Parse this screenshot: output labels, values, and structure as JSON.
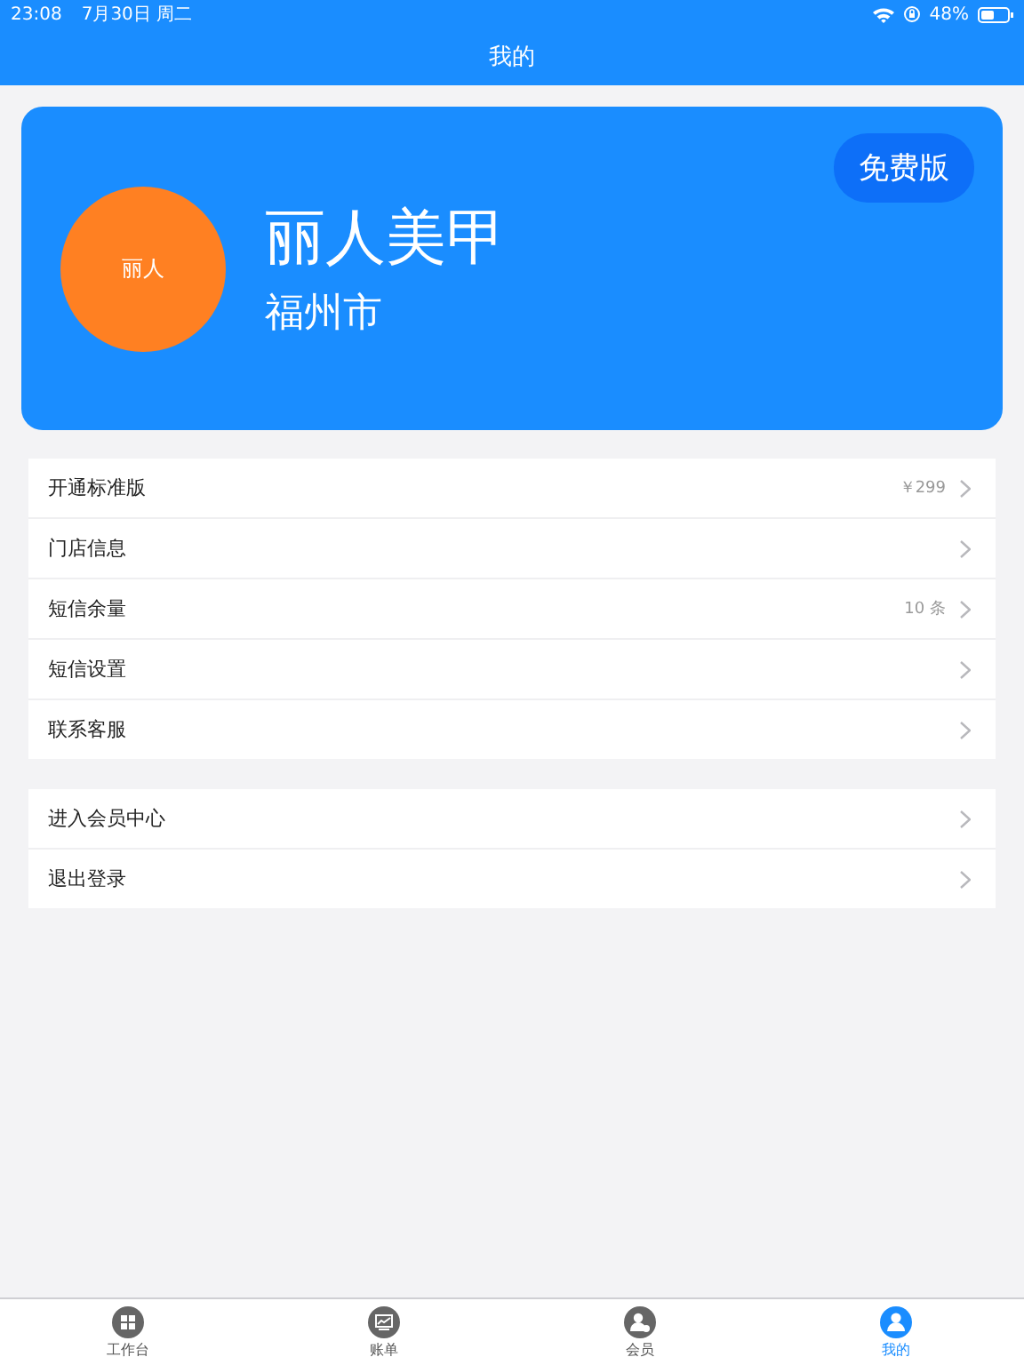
{
  "status_bar": {
    "time": "23:08",
    "date": "7月30日 周二",
    "battery": "48%"
  },
  "nav": {
    "title": "我的"
  },
  "profile": {
    "avatar_text": "丽人",
    "name": "丽人美甲",
    "city": "福州市",
    "badge": "免费版"
  },
  "groups": [
    {
      "items": [
        {
          "label": "开通标准版",
          "value": "￥299"
        },
        {
          "label": "门店信息"
        },
        {
          "label": "短信余量",
          "value": "10 条"
        },
        {
          "label": "短信设置"
        },
        {
          "label": "联系客服"
        }
      ]
    },
    {
      "items": [
        {
          "label": "进入会员中心"
        },
        {
          "label": "退出登录"
        }
      ]
    }
  ],
  "tabs": [
    {
      "kind": "grid",
      "label": "工作台",
      "selected": false
    },
    {
      "kind": "chart",
      "label": "账单",
      "selected": false
    },
    {
      "kind": "member",
      "label": "会员",
      "selected": false
    },
    {
      "kind": "person",
      "label": "我的",
      "selected": true
    }
  ]
}
